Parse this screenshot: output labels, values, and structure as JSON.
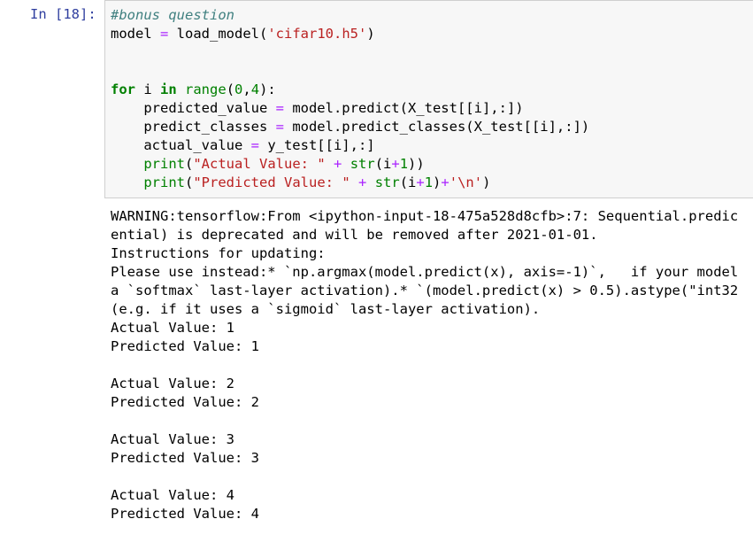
{
  "cell": {
    "prompt": "In [18]:",
    "code_lines": [
      [
        {
          "t": "comment",
          "v": "#bonus question"
        }
      ],
      [
        {
          "t": "plain",
          "v": "model "
        },
        {
          "t": "op",
          "v": "="
        },
        {
          "t": "plain",
          "v": " load_model("
        },
        {
          "t": "str",
          "v": "'cifar10.h5'"
        },
        {
          "t": "plain",
          "v": ")"
        }
      ],
      [],
      [],
      [
        {
          "t": "kw",
          "v": "for"
        },
        {
          "t": "plain",
          "v": " i "
        },
        {
          "t": "kw",
          "v": "in"
        },
        {
          "t": "plain",
          "v": " "
        },
        {
          "t": "builtin",
          "v": "range"
        },
        {
          "t": "plain",
          "v": "("
        },
        {
          "t": "num",
          "v": "0"
        },
        {
          "t": "plain",
          "v": ","
        },
        {
          "t": "num",
          "v": "4"
        },
        {
          "t": "plain",
          "v": "):"
        }
      ],
      [
        {
          "t": "plain",
          "v": "    predicted_value "
        },
        {
          "t": "op",
          "v": "="
        },
        {
          "t": "plain",
          "v": " model.predict(X_test[[i],:])"
        }
      ],
      [
        {
          "t": "plain",
          "v": "    predict_classes "
        },
        {
          "t": "op",
          "v": "="
        },
        {
          "t": "plain",
          "v": " model.predict_classes(X_test[[i],:])"
        }
      ],
      [
        {
          "t": "plain",
          "v": "    actual_value "
        },
        {
          "t": "op",
          "v": "="
        },
        {
          "t": "plain",
          "v": " y_test[[i],:]"
        }
      ],
      [
        {
          "t": "plain",
          "v": "    "
        },
        {
          "t": "builtin",
          "v": "print"
        },
        {
          "t": "plain",
          "v": "("
        },
        {
          "t": "str",
          "v": "\"Actual Value: \""
        },
        {
          "t": "plain",
          "v": " "
        },
        {
          "t": "op",
          "v": "+"
        },
        {
          "t": "plain",
          "v": " "
        },
        {
          "t": "builtin",
          "v": "str"
        },
        {
          "t": "plain",
          "v": "(i"
        },
        {
          "t": "op",
          "v": "+"
        },
        {
          "t": "num",
          "v": "1"
        },
        {
          "t": "plain",
          "v": "))"
        }
      ],
      [
        {
          "t": "plain",
          "v": "    "
        },
        {
          "t": "builtin",
          "v": "print"
        },
        {
          "t": "plain",
          "v": "("
        },
        {
          "t": "str",
          "v": "\"Predicted Value: \""
        },
        {
          "t": "plain",
          "v": " "
        },
        {
          "t": "op",
          "v": "+"
        },
        {
          "t": "plain",
          "v": " "
        },
        {
          "t": "builtin",
          "v": "str"
        },
        {
          "t": "plain",
          "v": "(i"
        },
        {
          "t": "op",
          "v": "+"
        },
        {
          "t": "num",
          "v": "1"
        },
        {
          "t": "plain",
          "v": ")"
        },
        {
          "t": "op",
          "v": "+"
        },
        {
          "t": "str",
          "v": "'\\n'"
        },
        {
          "t": "plain",
          "v": ")"
        }
      ]
    ],
    "output_lines": [
      "WARNING:tensorflow:From <ipython-input-18-475a528d8cfb>:7: Sequential.predic",
      "ential) is deprecated and will be removed after 2021-01-01.",
      "Instructions for updating:",
      "Please use instead:* `np.argmax(model.predict(x), axis=-1)`,   if your model",
      "a `softmax` last-layer activation).* `(model.predict(x) > 0.5).astype(\"int32",
      "(e.g. if it uses a `sigmoid` last-layer activation).",
      "Actual Value: 1",
      "Predicted Value: 1",
      "",
      "Actual Value: 2",
      "Predicted Value: 2",
      "",
      "Actual Value: 3",
      "Predicted Value: 3",
      "",
      "Actual Value: 4",
      "Predicted Value: 4"
    ]
  },
  "colors": {
    "prompt": "#303f9f",
    "comment": "#408080",
    "keyword": "#008000",
    "string": "#ba2121",
    "operator": "#aa22ff",
    "input_background": "#f7f7f7",
    "input_border": "#cfcfcf"
  }
}
